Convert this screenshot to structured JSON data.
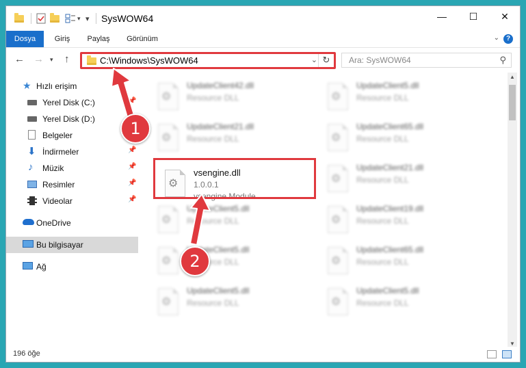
{
  "window": {
    "title": "SysWOW64"
  },
  "ribbon": {
    "tabs": [
      "Dosya",
      "Giriş",
      "Paylaş",
      "Görünüm"
    ]
  },
  "address": {
    "path": "C:\\Windows\\SysWOW64"
  },
  "search": {
    "placeholder": "Ara: SysWOW64"
  },
  "sidebar": {
    "items": [
      {
        "label": "Hızlı erişim"
      },
      {
        "label": "Yerel Disk (C:)"
      },
      {
        "label": "Yerel Disk (D:)"
      },
      {
        "label": "Belgeler"
      },
      {
        "label": "İndirmeler"
      },
      {
        "label": "Müzik"
      },
      {
        "label": "Resimler"
      },
      {
        "label": "Videolar"
      },
      {
        "label": "OneDrive"
      },
      {
        "label": "Bu bilgisayar"
      },
      {
        "label": "Ağ"
      }
    ]
  },
  "files": {
    "left": [
      {
        "name": "UpdateClient42.dll",
        "sub": "Resource DLL"
      },
      {
        "name": "UpdateClient21.dll",
        "sub": "Resource DLL"
      },
      {
        "name": "vsengine.dll",
        "sub": "1.0.0.1",
        "sub2": "vsengine Module"
      },
      {
        "name": "UpdateClient5.dll",
        "sub": "Resource DLL"
      },
      {
        "name": "UpdateClient5.dll",
        "sub": "Resource DLL"
      },
      {
        "name": "UpdateClient5.dll",
        "sub": "Resource DLL"
      }
    ],
    "right": [
      {
        "name": "UpdateClient5.dll",
        "sub": "Resource DLL"
      },
      {
        "name": "UpdateClient65.dll",
        "sub": "Resource DLL"
      },
      {
        "name": "UpdateClient21.dll",
        "sub": "Resource DLL"
      },
      {
        "name": "UpdateClient19.dll",
        "sub": "Resource DLL"
      },
      {
        "name": "UpdateClient65.dll",
        "sub": "Resource DLL"
      },
      {
        "name": "UpdateClient5.dll",
        "sub": "Resource DLL"
      }
    ]
  },
  "status": {
    "count": "196 öğe"
  },
  "annotations": {
    "step1": "1",
    "step2": "2"
  },
  "colors": {
    "accent": "#1a6fcb",
    "highlight": "#e0393e",
    "background": "#2aa6b3"
  }
}
